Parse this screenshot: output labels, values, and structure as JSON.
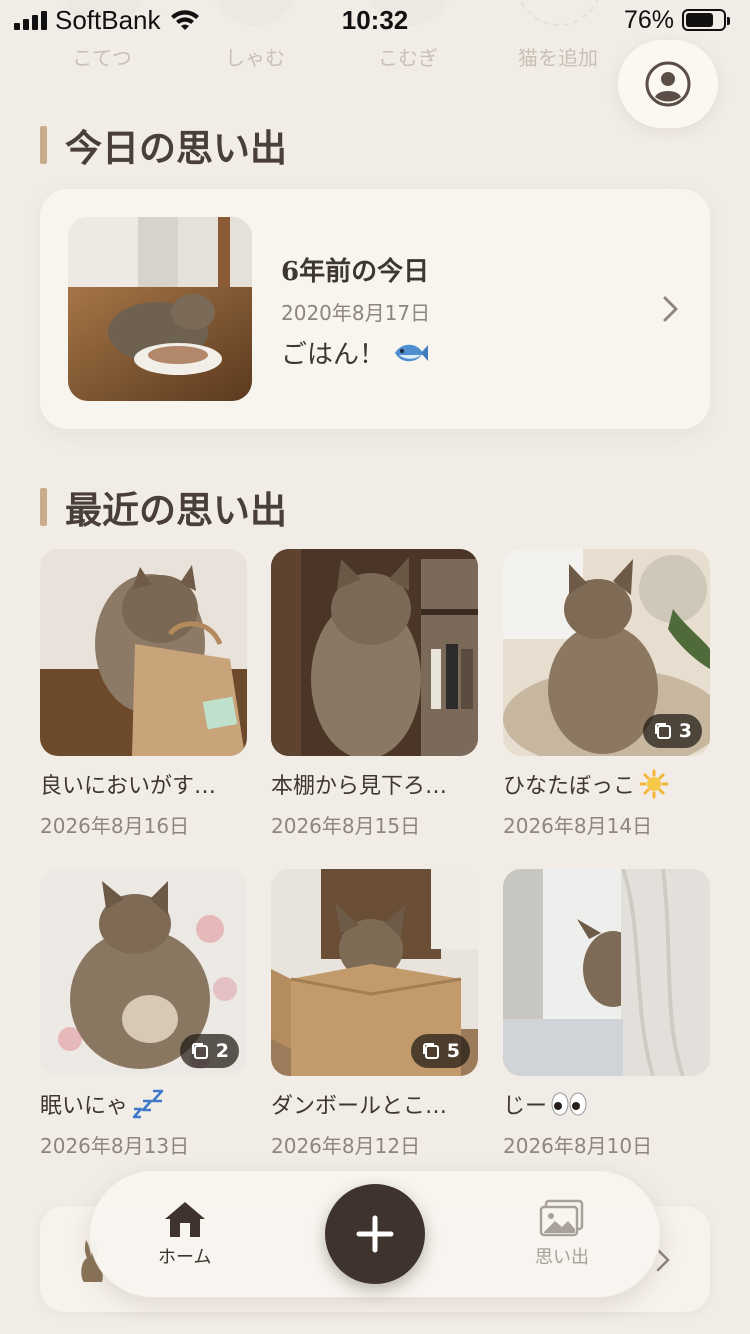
{
  "status_bar": {
    "carrier": "SoftBank",
    "time": "10:32",
    "battery_percent": "76%",
    "battery_level": 0.76
  },
  "cat_tabs": [
    {
      "name": "こてつ"
    },
    {
      "name": "しゃむ"
    },
    {
      "name": "こむぎ"
    },
    {
      "name": "猫を追加"
    }
  ],
  "today_section": {
    "title": "今日の思い出",
    "card": {
      "heading": "6年前の今日",
      "date": "2020年8月17日",
      "caption": "ごはん！",
      "emoji": "fish"
    }
  },
  "recent_section": {
    "title": "最近の思い出",
    "items": [
      {
        "caption": "良いにおいがす…",
        "date": "2026年8月16日",
        "count": null
      },
      {
        "caption": "本棚から見下ろ…",
        "date": "2026年8月15日",
        "count": null
      },
      {
        "caption": "ひなたぼっこ",
        "date": "2026年8月14日",
        "count": "3",
        "emoji": "sun"
      },
      {
        "caption": "眠いにゃ",
        "date": "2026年8月13日",
        "count": "2",
        "emoji": "zzz"
      },
      {
        "caption": "ダンボールとこ…",
        "date": "2026年8月12日",
        "count": "5"
      },
      {
        "caption": "じー",
        "date": "2026年8月10日",
        "count": null,
        "emoji": "eyes"
      }
    ]
  },
  "bottom_nav": {
    "home_label": "ホーム",
    "memories_label": "思い出",
    "add_icon": "plus-icon"
  },
  "colors": {
    "background": "#f1ede6",
    "card": "#f8f5ef",
    "accent_bar": "#c9ad8a",
    "fab": "#3f342d",
    "text": "#3e3631",
    "muted": "#8e857c"
  }
}
